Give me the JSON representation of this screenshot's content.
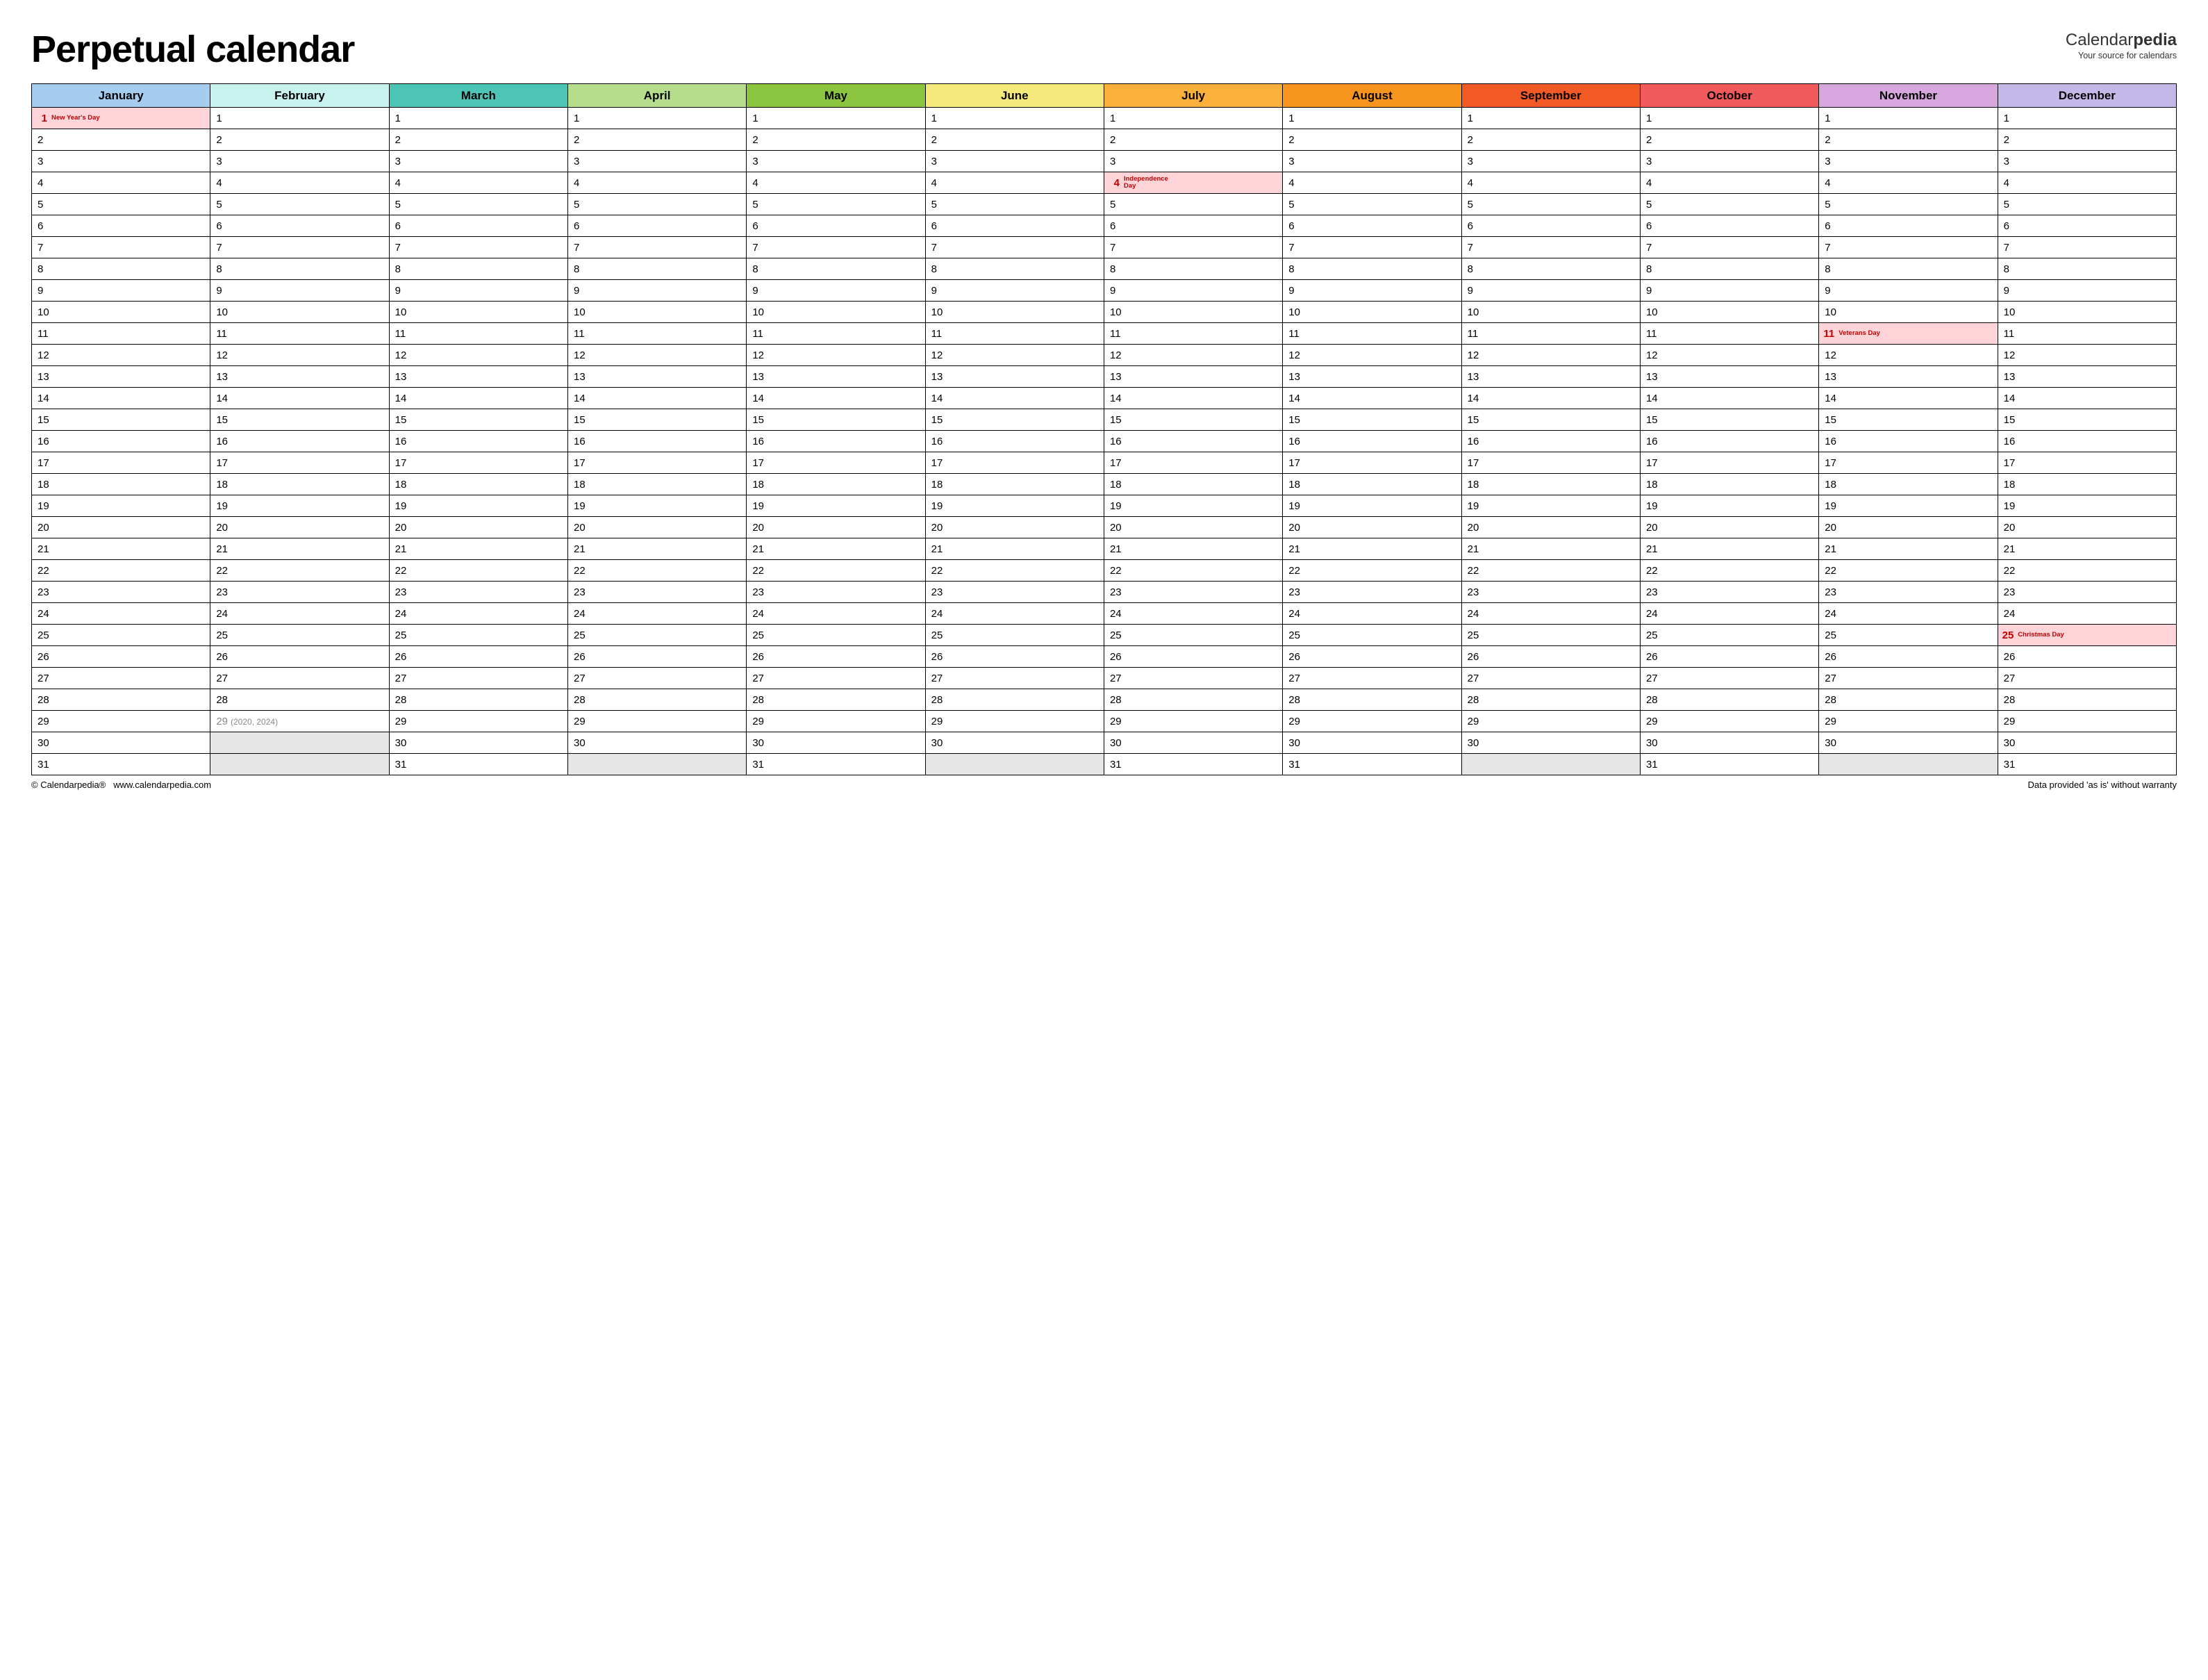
{
  "title": "Perpetual calendar",
  "brand": {
    "name_left": "Calendar",
    "name_right": "pedia",
    "tagline": "Your source for calendars"
  },
  "months": [
    {
      "name": "January",
      "color": "#a5cdf0",
      "days": 31
    },
    {
      "name": "February",
      "color": "#c8f2ed",
      "days": 29
    },
    {
      "name": "March",
      "color": "#4cc5b7",
      "days": 31
    },
    {
      "name": "April",
      "color": "#b5dd8c",
      "days": 30
    },
    {
      "name": "May",
      "color": "#8bc53f",
      "days": 31
    },
    {
      "name": "June",
      "color": "#f4e97a",
      "days": 30
    },
    {
      "name": "July",
      "color": "#fbb03b",
      "days": 31
    },
    {
      "name": "August",
      "color": "#f7941e",
      "days": 31
    },
    {
      "name": "September",
      "color": "#f15a24",
      "days": 30
    },
    {
      "name": "October",
      "color": "#f05a5a",
      "days": 31
    },
    {
      "name": "November",
      "color": "#d8a6de",
      "days": 30
    },
    {
      "name": "December",
      "color": "#c4b8e8",
      "days": 31
    }
  ],
  "max_days": 31,
  "holidays": [
    {
      "month": 0,
      "day": 1,
      "name": "New Year's Day"
    },
    {
      "month": 6,
      "day": 4,
      "name": "Independence Day"
    },
    {
      "month": 10,
      "day": 11,
      "name": "Veterans Day"
    },
    {
      "month": 11,
      "day": 25,
      "name": "Christmas Day"
    }
  ],
  "leap_note": {
    "month": 1,
    "day": 29,
    "text": "(2020, 2024)"
  },
  "footer": {
    "left_copyright": "© Calendarpedia®",
    "left_url": "www.calendarpedia.com",
    "right": "Data provided 'as is' without warranty"
  }
}
